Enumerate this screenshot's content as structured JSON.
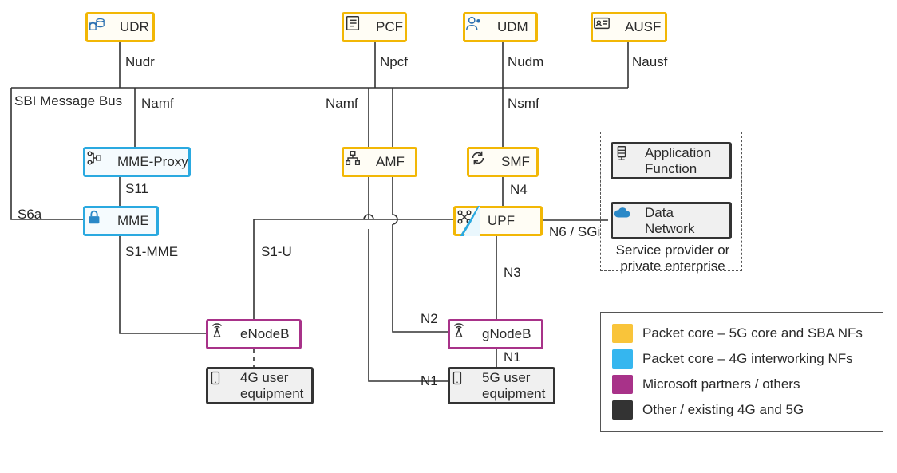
{
  "nodes": {
    "udr": {
      "label": "UDR"
    },
    "pcf": {
      "label": "PCF"
    },
    "udm": {
      "label": "UDM"
    },
    "ausf": {
      "label": "AUSF"
    },
    "mmeProxy": {
      "label": "MME-Proxy"
    },
    "amf": {
      "label": "AMF"
    },
    "smf": {
      "label": "SMF"
    },
    "mme": {
      "label": "MME"
    },
    "upf": {
      "label": "UPF"
    },
    "appFn": {
      "label": "Application Function"
    },
    "dataNet": {
      "label": "Data Network"
    },
    "enodeb": {
      "label": "eNodeB"
    },
    "gnodeb": {
      "label": "gNodeB"
    },
    "ue4g": {
      "label": "4G user equipment"
    },
    "ue5g": {
      "label": "5G user equipment"
    }
  },
  "edge_labels": {
    "nudr": "Nudr",
    "npcf": "Npcf",
    "nudm": "Nudm",
    "nausf": "Nausf",
    "sbi": "SBI Message Bus",
    "namf1": "Namf",
    "namf2": "Namf",
    "nsmf": "Nsmf",
    "s11": "S11",
    "s6a": "S6a",
    "s1mme": "S1-MME",
    "s1u": "S1-U",
    "n4": "N4",
    "n6sgi": "N6 / SGi",
    "n3": "N3",
    "n2": "N2",
    "n1a": "N1",
    "n1b": "N1",
    "enterprise": "Service provider or private enterprise"
  },
  "legend": {
    "items": [
      {
        "label": "Packet core – 5G core and SBA NFs"
      },
      {
        "label": "Packet core – 4G interworking NFs"
      },
      {
        "label": "Microsoft partners / others"
      },
      {
        "label": "Other / existing 4G and 5G"
      }
    ]
  }
}
